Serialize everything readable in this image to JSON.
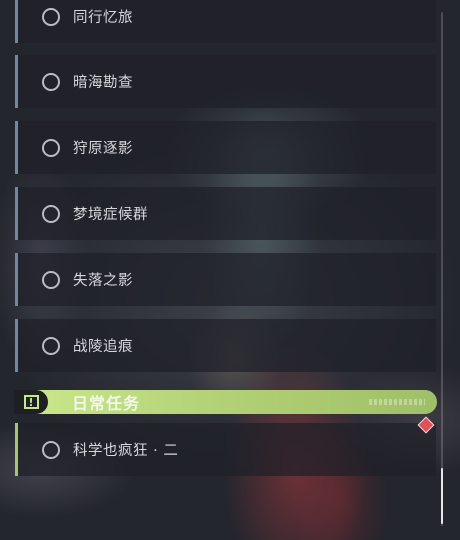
{
  "quests": [
    {
      "label": "同行忆旅"
    },
    {
      "label": "暗海勘查"
    },
    {
      "label": "狩原逐影"
    },
    {
      "label": "梦境症候群"
    },
    {
      "label": "失落之影"
    },
    {
      "label": "战陵追痕"
    }
  ],
  "daily_section": {
    "title": "日常任务",
    "badge_icon": "exclamation-icon",
    "accent_color": "#b4d277",
    "quests": [
      {
        "label": "科学也疯狂 · 二",
        "has_new_marker": true
      }
    ]
  },
  "scrollbar": {
    "position_fraction": 0.95
  }
}
